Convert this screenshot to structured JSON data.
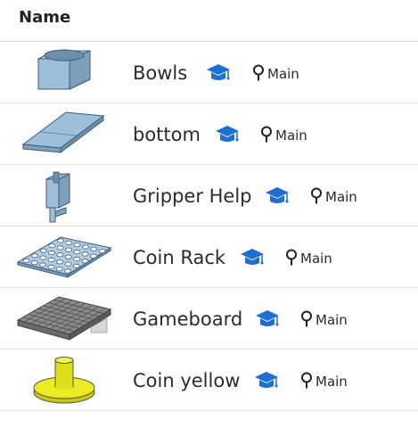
{
  "header": {
    "name_label": "Name"
  },
  "rows": [
    {
      "name": "Bowls",
      "branch": "Main",
      "thumbnail": "bowl-part-thumbnail",
      "badge_icon": "graduation-cap-icon",
      "branch_icon": "branch-pin-icon"
    },
    {
      "name": "bottom",
      "branch": "Main",
      "thumbnail": "plate-part-thumbnail",
      "badge_icon": "graduation-cap-icon",
      "branch_icon": "branch-pin-icon"
    },
    {
      "name": "Gripper Help",
      "branch": "Main",
      "thumbnail": "gripper-part-thumbnail",
      "badge_icon": "graduation-cap-icon",
      "branch_icon": "branch-pin-icon"
    },
    {
      "name": "Coin Rack",
      "branch": "Main",
      "thumbnail": "coin-rack-thumbnail",
      "badge_icon": "graduation-cap-icon",
      "branch_icon": "branch-pin-icon"
    },
    {
      "name": "Gameboard",
      "branch": "Main",
      "thumbnail": "gameboard-thumbnail",
      "badge_icon": "graduation-cap-icon",
      "branch_icon": "branch-pin-icon"
    },
    {
      "name": "Coin yellow",
      "branch": "Main",
      "thumbnail": "yellow-coin-thumbnail",
      "badge_icon": "graduation-cap-icon",
      "branch_icon": "branch-pin-icon"
    }
  ],
  "colors": {
    "part_blue": "#8fb3cf",
    "badge_blue": "#1f6fd1",
    "coin_yellow": "#ecec22",
    "board_gray": "#7a7a7a"
  }
}
